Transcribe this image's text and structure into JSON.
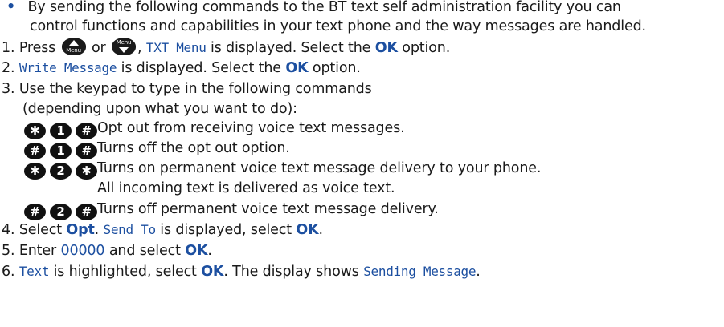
{
  "colors": {
    "accent": "#1c4fa0",
    "text": "#1a1a1a",
    "key": "#111111"
  },
  "bullet": {
    "symbol": "•",
    "line1": "By sending the following commands to the BT text self administration facility you can",
    "line2": "control functions and capabilities in your text phone and the way messages are handled."
  },
  "step1": {
    "num": "1.",
    "pre": "Press",
    "or": "or",
    "up_key_caption": "Menu",
    "down_key_caption": "Menu",
    "comma": ",",
    "lcd": "TXT Menu",
    "mid": "is displayed. Select the",
    "ok": "OK",
    "post": "option."
  },
  "step2": {
    "num": "2.",
    "lcd": "Write Message",
    "mid": "is displayed. Select the",
    "ok": "OK",
    "post": "option."
  },
  "step3": {
    "num": "3.",
    "line1": "Use the keypad to type in the following commands",
    "line2": "(depending upon what you want to do):"
  },
  "commands": [
    {
      "keys": [
        "✱",
        "1",
        "#"
      ],
      "text": "Opt out from receiving voice text messages.",
      "text2": ""
    },
    {
      "keys": [
        "#",
        "1",
        "#"
      ],
      "text": "Turns off the opt out option.",
      "text2": ""
    },
    {
      "keys": [
        "✱",
        "2",
        "✱"
      ],
      "text": "Turns on permanent voice text message delivery to your phone.",
      "text2": "All incoming text is delivered as voice text."
    },
    {
      "keys": [
        "#",
        "2",
        "#"
      ],
      "text": "Turns off permanent voice text message delivery.",
      "text2": ""
    }
  ],
  "step4": {
    "num": "4.",
    "pre": "Select",
    "opt": "Opt",
    "dot": ".",
    "lcd": "Send To",
    "mid": "is displayed, select",
    "ok": "OK",
    "end": "."
  },
  "step5": {
    "num": "5.",
    "pre": "Enter",
    "code": "00000",
    "mid": "and select",
    "ok": "OK",
    "end": "."
  },
  "step6": {
    "num": "6.",
    "lcd": "Text",
    "mid": "is highlighted, select",
    "ok": "OK",
    "mid2": ". The display shows",
    "lcd2": "Sending Message",
    "end": "."
  }
}
